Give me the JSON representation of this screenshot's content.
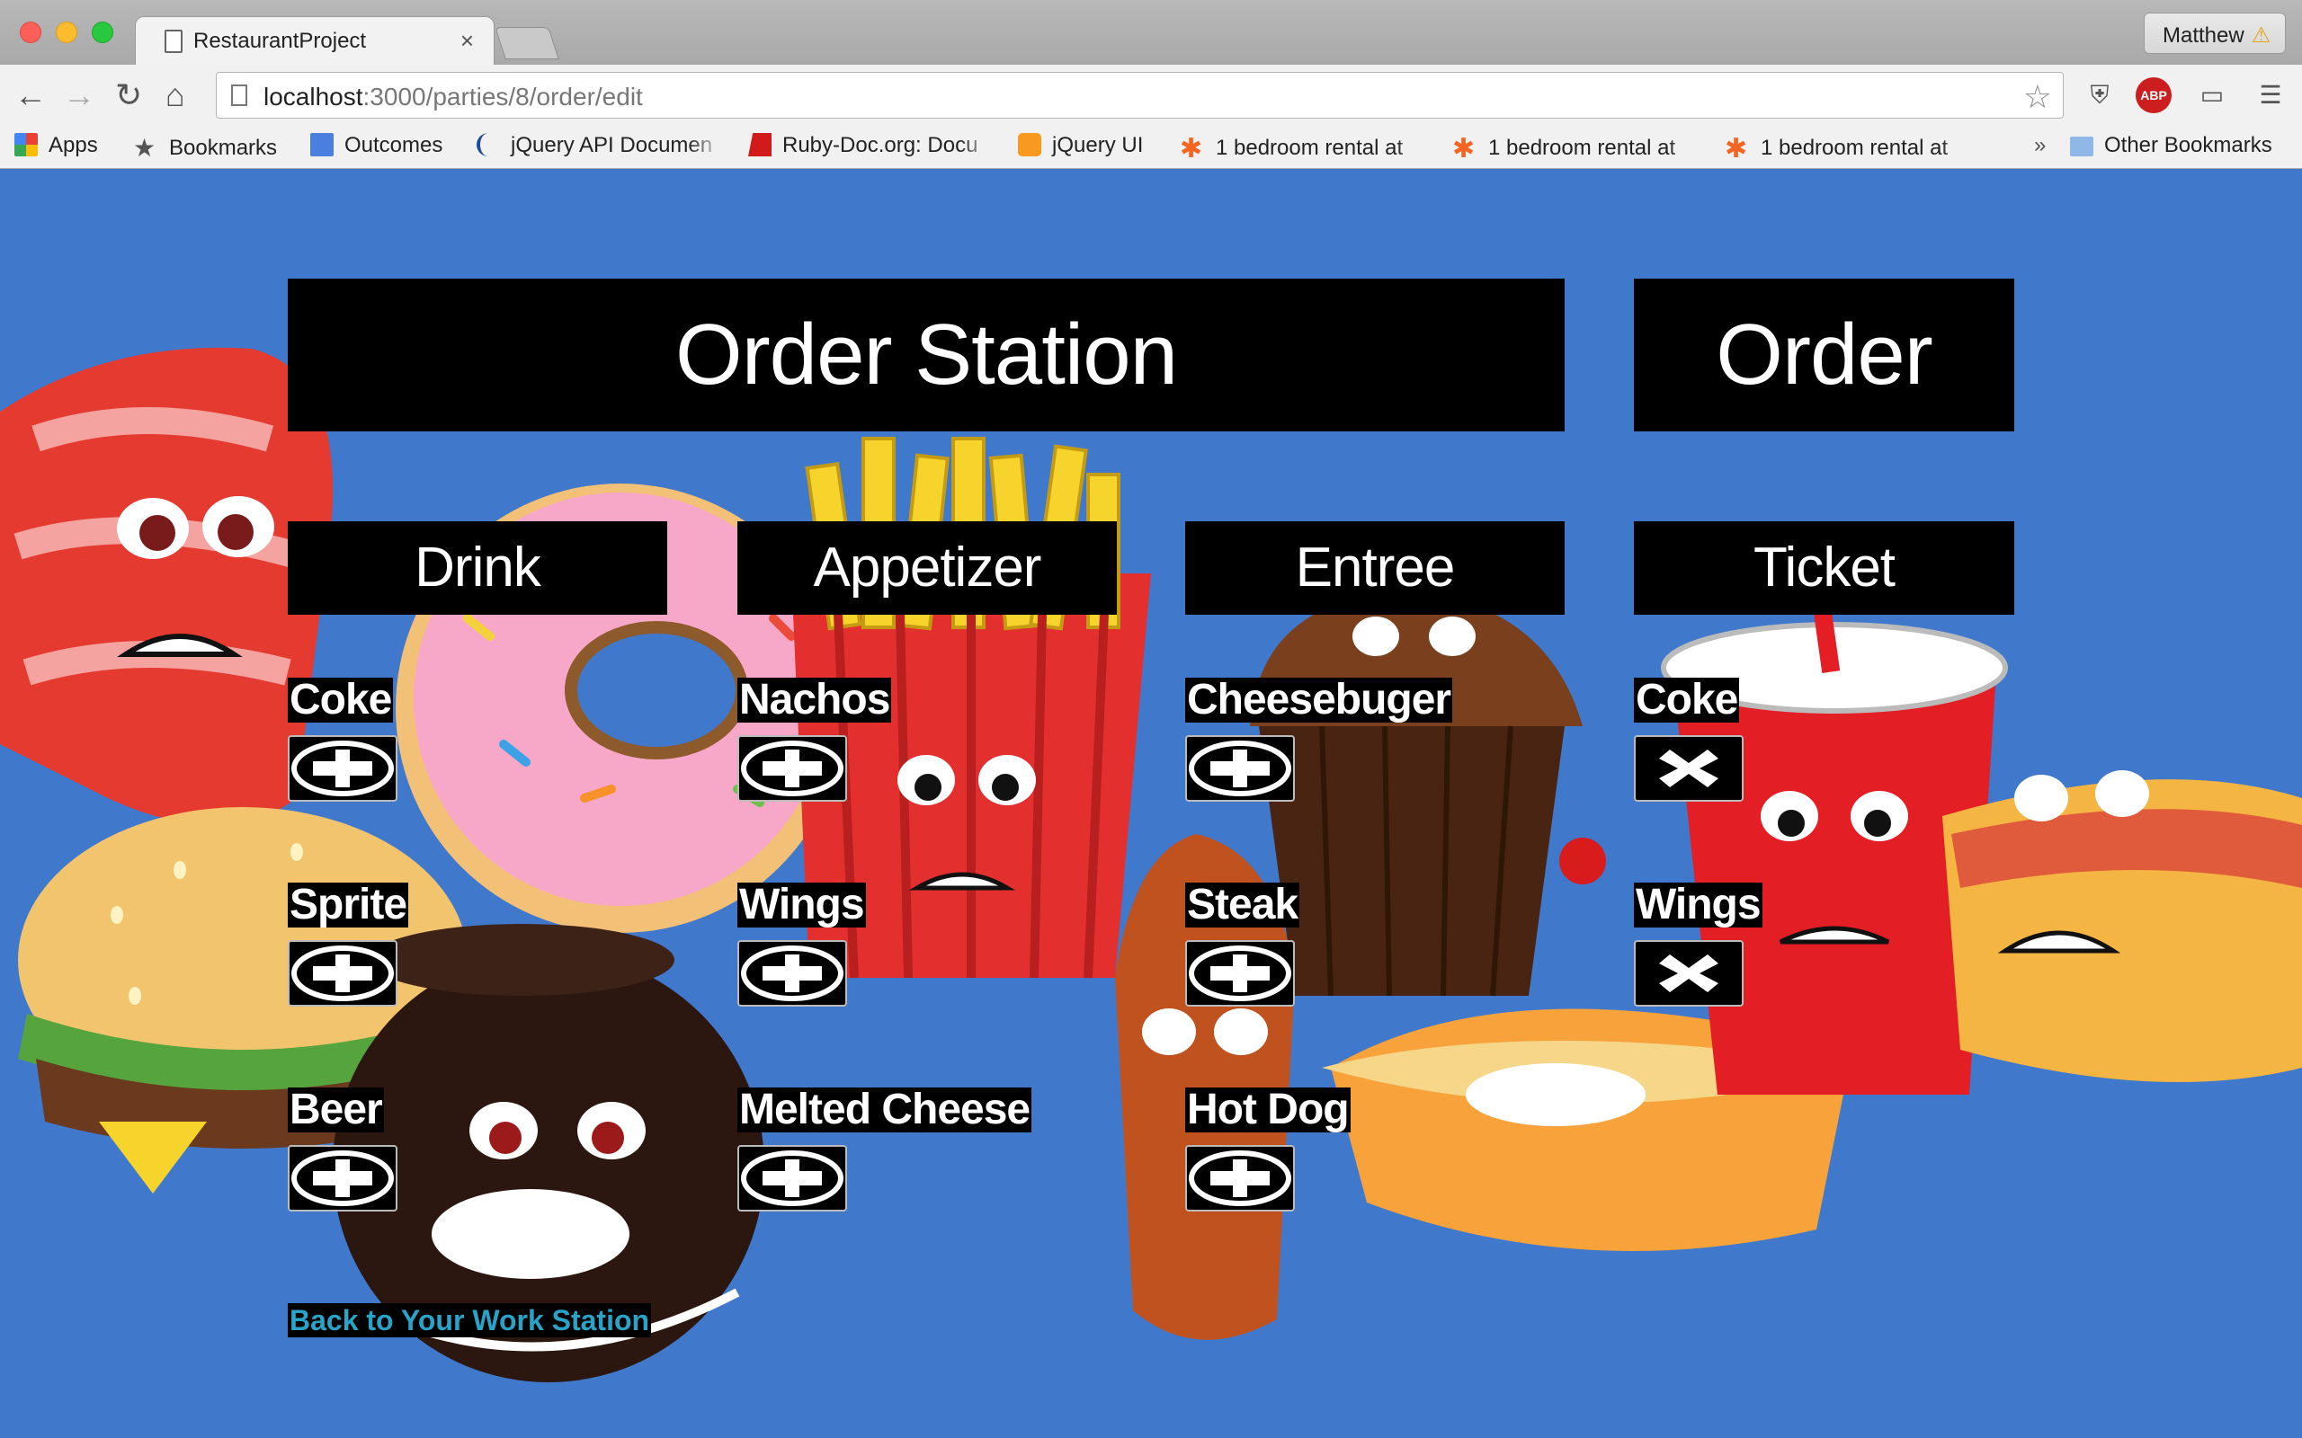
{
  "browser": {
    "tab_title": "RestaurantProject",
    "tab_close": "×",
    "profile_name": "Matthew",
    "profile_warning": "⚠",
    "url_host": "localhost",
    "url_rest": ":3000/parties/8/order/edit",
    "bookmarks": [
      {
        "label": "Apps",
        "icon": "apps-grid-icon"
      },
      {
        "label": "Bookmarks",
        "icon": "star-icon"
      },
      {
        "label": "Outcomes",
        "icon": "doc-icon"
      },
      {
        "label": "jQuery API Documen",
        "icon": "jquery-icon"
      },
      {
        "label": "Ruby-Doc.org: Docu",
        "icon": "ruby-icon"
      },
      {
        "label": "jQuery UI",
        "icon": "jquery-ui-icon"
      },
      {
        "label": "1 bedroom rental at",
        "icon": "craigslist-icon"
      },
      {
        "label": "1 bedroom rental at",
        "icon": "craigslist-icon"
      },
      {
        "label": "1 bedroom rental at",
        "icon": "craigslist-icon"
      }
    ],
    "more_bookmarks": "»",
    "other_bookmarks": "Other Bookmarks"
  },
  "page": {
    "title": "Order Station",
    "order_title": "Order",
    "categories": [
      "Drink",
      "Appetizer",
      "Entree"
    ],
    "ticket_title": "Ticket",
    "drink": [
      "Coke",
      "Sprite",
      "Beer"
    ],
    "appetizer": [
      "Nachos",
      "Wings",
      "Melted Cheese"
    ],
    "entree": [
      "Cheesebuger",
      "Steak",
      "Hot Dog"
    ],
    "ticket_items": [
      "Coke",
      "Wings"
    ],
    "back_link": "Back to Your Work Station"
  },
  "colors": {
    "background": "#4079cc",
    "link": "#2aa3c9"
  }
}
